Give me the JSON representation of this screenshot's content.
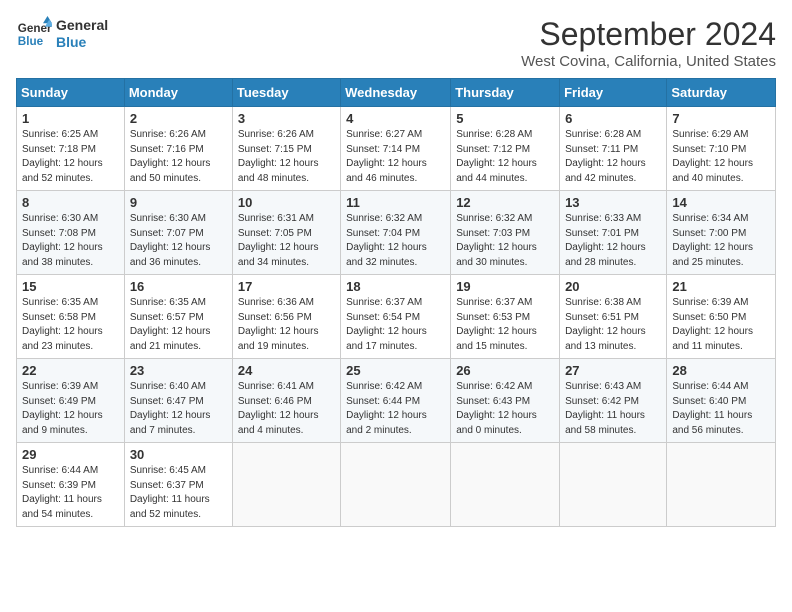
{
  "header": {
    "logo_line1": "General",
    "logo_line2": "Blue",
    "month_title": "September 2024",
    "location": "West Covina, California, United States"
  },
  "days_of_week": [
    "Sunday",
    "Monday",
    "Tuesday",
    "Wednesday",
    "Thursday",
    "Friday",
    "Saturday"
  ],
  "weeks": [
    [
      {
        "day": "1",
        "info": "Sunrise: 6:25 AM\nSunset: 7:18 PM\nDaylight: 12 hours\nand 52 minutes."
      },
      {
        "day": "2",
        "info": "Sunrise: 6:26 AM\nSunset: 7:16 PM\nDaylight: 12 hours\nand 50 minutes."
      },
      {
        "day": "3",
        "info": "Sunrise: 6:26 AM\nSunset: 7:15 PM\nDaylight: 12 hours\nand 48 minutes."
      },
      {
        "day": "4",
        "info": "Sunrise: 6:27 AM\nSunset: 7:14 PM\nDaylight: 12 hours\nand 46 minutes."
      },
      {
        "day": "5",
        "info": "Sunrise: 6:28 AM\nSunset: 7:12 PM\nDaylight: 12 hours\nand 44 minutes."
      },
      {
        "day": "6",
        "info": "Sunrise: 6:28 AM\nSunset: 7:11 PM\nDaylight: 12 hours\nand 42 minutes."
      },
      {
        "day": "7",
        "info": "Sunrise: 6:29 AM\nSunset: 7:10 PM\nDaylight: 12 hours\nand 40 minutes."
      }
    ],
    [
      {
        "day": "8",
        "info": "Sunrise: 6:30 AM\nSunset: 7:08 PM\nDaylight: 12 hours\nand 38 minutes."
      },
      {
        "day": "9",
        "info": "Sunrise: 6:30 AM\nSunset: 7:07 PM\nDaylight: 12 hours\nand 36 minutes."
      },
      {
        "day": "10",
        "info": "Sunrise: 6:31 AM\nSunset: 7:05 PM\nDaylight: 12 hours\nand 34 minutes."
      },
      {
        "day": "11",
        "info": "Sunrise: 6:32 AM\nSunset: 7:04 PM\nDaylight: 12 hours\nand 32 minutes."
      },
      {
        "day": "12",
        "info": "Sunrise: 6:32 AM\nSunset: 7:03 PM\nDaylight: 12 hours\nand 30 minutes."
      },
      {
        "day": "13",
        "info": "Sunrise: 6:33 AM\nSunset: 7:01 PM\nDaylight: 12 hours\nand 28 minutes."
      },
      {
        "day": "14",
        "info": "Sunrise: 6:34 AM\nSunset: 7:00 PM\nDaylight: 12 hours\nand 25 minutes."
      }
    ],
    [
      {
        "day": "15",
        "info": "Sunrise: 6:35 AM\nSunset: 6:58 PM\nDaylight: 12 hours\nand 23 minutes."
      },
      {
        "day": "16",
        "info": "Sunrise: 6:35 AM\nSunset: 6:57 PM\nDaylight: 12 hours\nand 21 minutes."
      },
      {
        "day": "17",
        "info": "Sunrise: 6:36 AM\nSunset: 6:56 PM\nDaylight: 12 hours\nand 19 minutes."
      },
      {
        "day": "18",
        "info": "Sunrise: 6:37 AM\nSunset: 6:54 PM\nDaylight: 12 hours\nand 17 minutes."
      },
      {
        "day": "19",
        "info": "Sunrise: 6:37 AM\nSunset: 6:53 PM\nDaylight: 12 hours\nand 15 minutes."
      },
      {
        "day": "20",
        "info": "Sunrise: 6:38 AM\nSunset: 6:51 PM\nDaylight: 12 hours\nand 13 minutes."
      },
      {
        "day": "21",
        "info": "Sunrise: 6:39 AM\nSunset: 6:50 PM\nDaylight: 12 hours\nand 11 minutes."
      }
    ],
    [
      {
        "day": "22",
        "info": "Sunrise: 6:39 AM\nSunset: 6:49 PM\nDaylight: 12 hours\nand 9 minutes."
      },
      {
        "day": "23",
        "info": "Sunrise: 6:40 AM\nSunset: 6:47 PM\nDaylight: 12 hours\nand 7 minutes."
      },
      {
        "day": "24",
        "info": "Sunrise: 6:41 AM\nSunset: 6:46 PM\nDaylight: 12 hours\nand 4 minutes."
      },
      {
        "day": "25",
        "info": "Sunrise: 6:42 AM\nSunset: 6:44 PM\nDaylight: 12 hours\nand 2 minutes."
      },
      {
        "day": "26",
        "info": "Sunrise: 6:42 AM\nSunset: 6:43 PM\nDaylight: 12 hours\nand 0 minutes."
      },
      {
        "day": "27",
        "info": "Sunrise: 6:43 AM\nSunset: 6:42 PM\nDaylight: 11 hours\nand 58 minutes."
      },
      {
        "day": "28",
        "info": "Sunrise: 6:44 AM\nSunset: 6:40 PM\nDaylight: 11 hours\nand 56 minutes."
      }
    ],
    [
      {
        "day": "29",
        "info": "Sunrise: 6:44 AM\nSunset: 6:39 PM\nDaylight: 11 hours\nand 54 minutes."
      },
      {
        "day": "30",
        "info": "Sunrise: 6:45 AM\nSunset: 6:37 PM\nDaylight: 11 hours\nand 52 minutes."
      },
      {
        "day": "",
        "info": ""
      },
      {
        "day": "",
        "info": ""
      },
      {
        "day": "",
        "info": ""
      },
      {
        "day": "",
        "info": ""
      },
      {
        "day": "",
        "info": ""
      }
    ]
  ]
}
